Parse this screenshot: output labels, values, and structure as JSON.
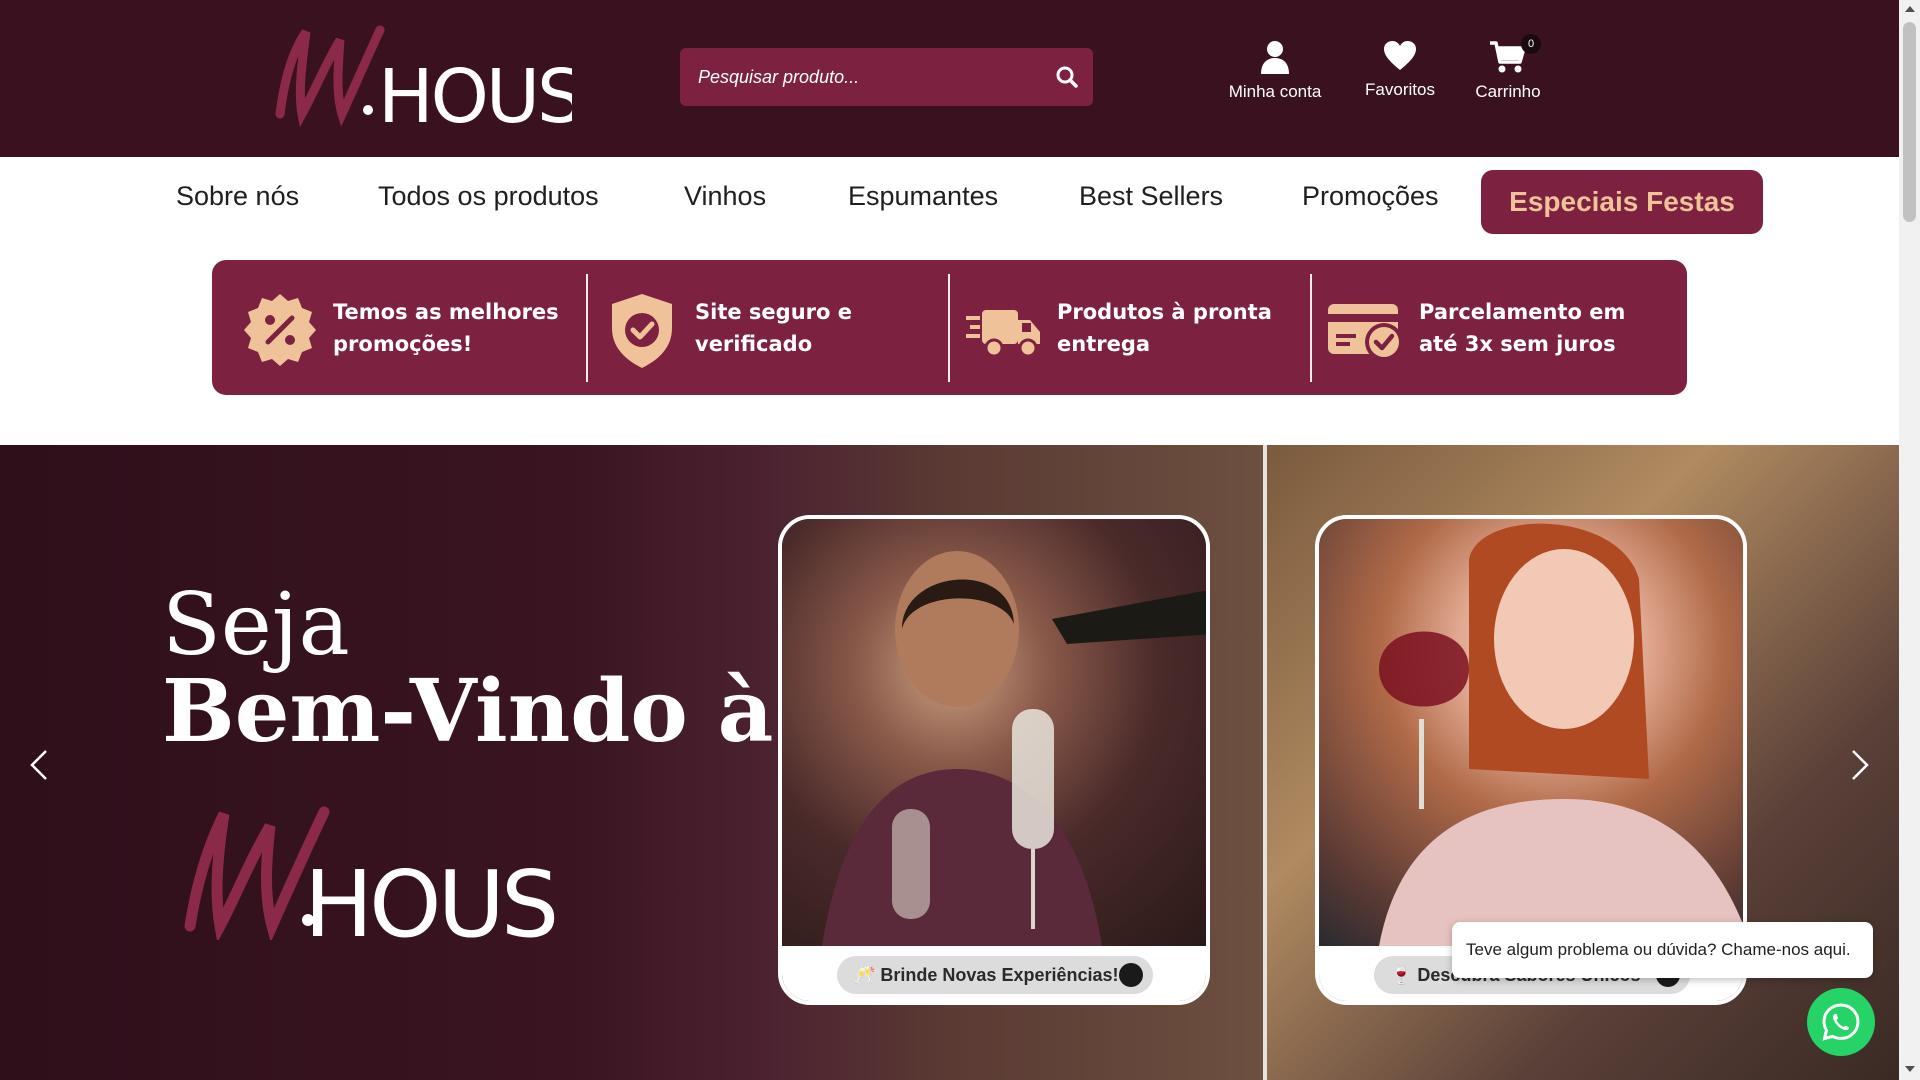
{
  "colors": {
    "header_bg": "#3a121f",
    "accent": "#7c2240",
    "accent_text": "#f0c29a",
    "whatsapp": "#25d366"
  },
  "header": {
    "logo": {
      "letter": "W",
      "word": "HOUSE"
    },
    "search": {
      "placeholder": "Pesquisar produto...",
      "value": "",
      "icon": "search-icon"
    },
    "account": {
      "label": "Minha conta",
      "icon": "user-icon"
    },
    "favorites": {
      "label": "Favoritos",
      "icon": "heart-icon"
    },
    "cart": {
      "label": "Carrinho",
      "icon": "cart-icon",
      "count": "0"
    }
  },
  "nav": {
    "items": [
      {
        "label": "Sobre nós"
      },
      {
        "label": "Todos os produtos"
      },
      {
        "label": "Vinhos"
      },
      {
        "label": "Espumantes"
      },
      {
        "label": "Best Sellers"
      },
      {
        "label": "Promoções"
      }
    ],
    "special": {
      "label": "Especiais Festas"
    }
  },
  "benefits": [
    {
      "icon": "discount-badge-icon",
      "text": "Temos as melhores promoções!"
    },
    {
      "icon": "shield-check-icon",
      "text": "Site seguro e verificado"
    },
    {
      "icon": "delivery-truck-icon",
      "text": "Produtos à pronta entrega"
    },
    {
      "icon": "card-check-icon",
      "text": "Parcelamento em até 3x sem juros"
    }
  ],
  "hero": {
    "title_line1": "Seja",
    "title_line2": "Bem-Vindo à",
    "logo": {
      "letter": "W",
      "word": "HOUSE"
    },
    "cards": [
      {
        "pill": "🥂 Brinde Novas Experiências!"
      },
      {
        "pill": "🍷 Descubra Sabores Únicos"
      }
    ]
  },
  "chat": {
    "bubble": "Teve algum problema ou dúvida? Chame-nos aqui.",
    "icon": "whatsapp-icon"
  }
}
